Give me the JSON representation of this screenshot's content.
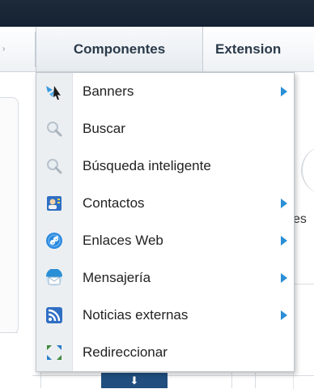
{
  "menubar": {
    "items": [
      {
        "label": "Componentes"
      },
      {
        "label": "Extension"
      }
    ]
  },
  "dropdown": {
    "items": [
      {
        "label": "Banners",
        "icon": "banners-icon",
        "has_submenu": true
      },
      {
        "label": "Buscar",
        "icon": "search-icon",
        "has_submenu": false
      },
      {
        "label": "Búsqueda inteligente",
        "icon": "smart-search-icon",
        "has_submenu": false
      },
      {
        "label": "Contactos",
        "icon": "contacts-icon",
        "has_submenu": true
      },
      {
        "label": "Enlaces Web",
        "icon": "web-links-icon",
        "has_submenu": true
      },
      {
        "label": "Mensajería",
        "icon": "messaging-icon",
        "has_submenu": true
      },
      {
        "label": "Noticias externas",
        "icon": "rss-icon",
        "has_submenu": true
      },
      {
        "label": "Redireccionar",
        "icon": "redirect-icon",
        "has_submenu": false
      }
    ]
  },
  "background": {
    "right_text": "es"
  },
  "colors": {
    "topbar": "#1d2a38",
    "submenu_arrow": "#2a8fd6",
    "icon_column": "#eceff2",
    "bottom_button": "#1f4e7f"
  }
}
